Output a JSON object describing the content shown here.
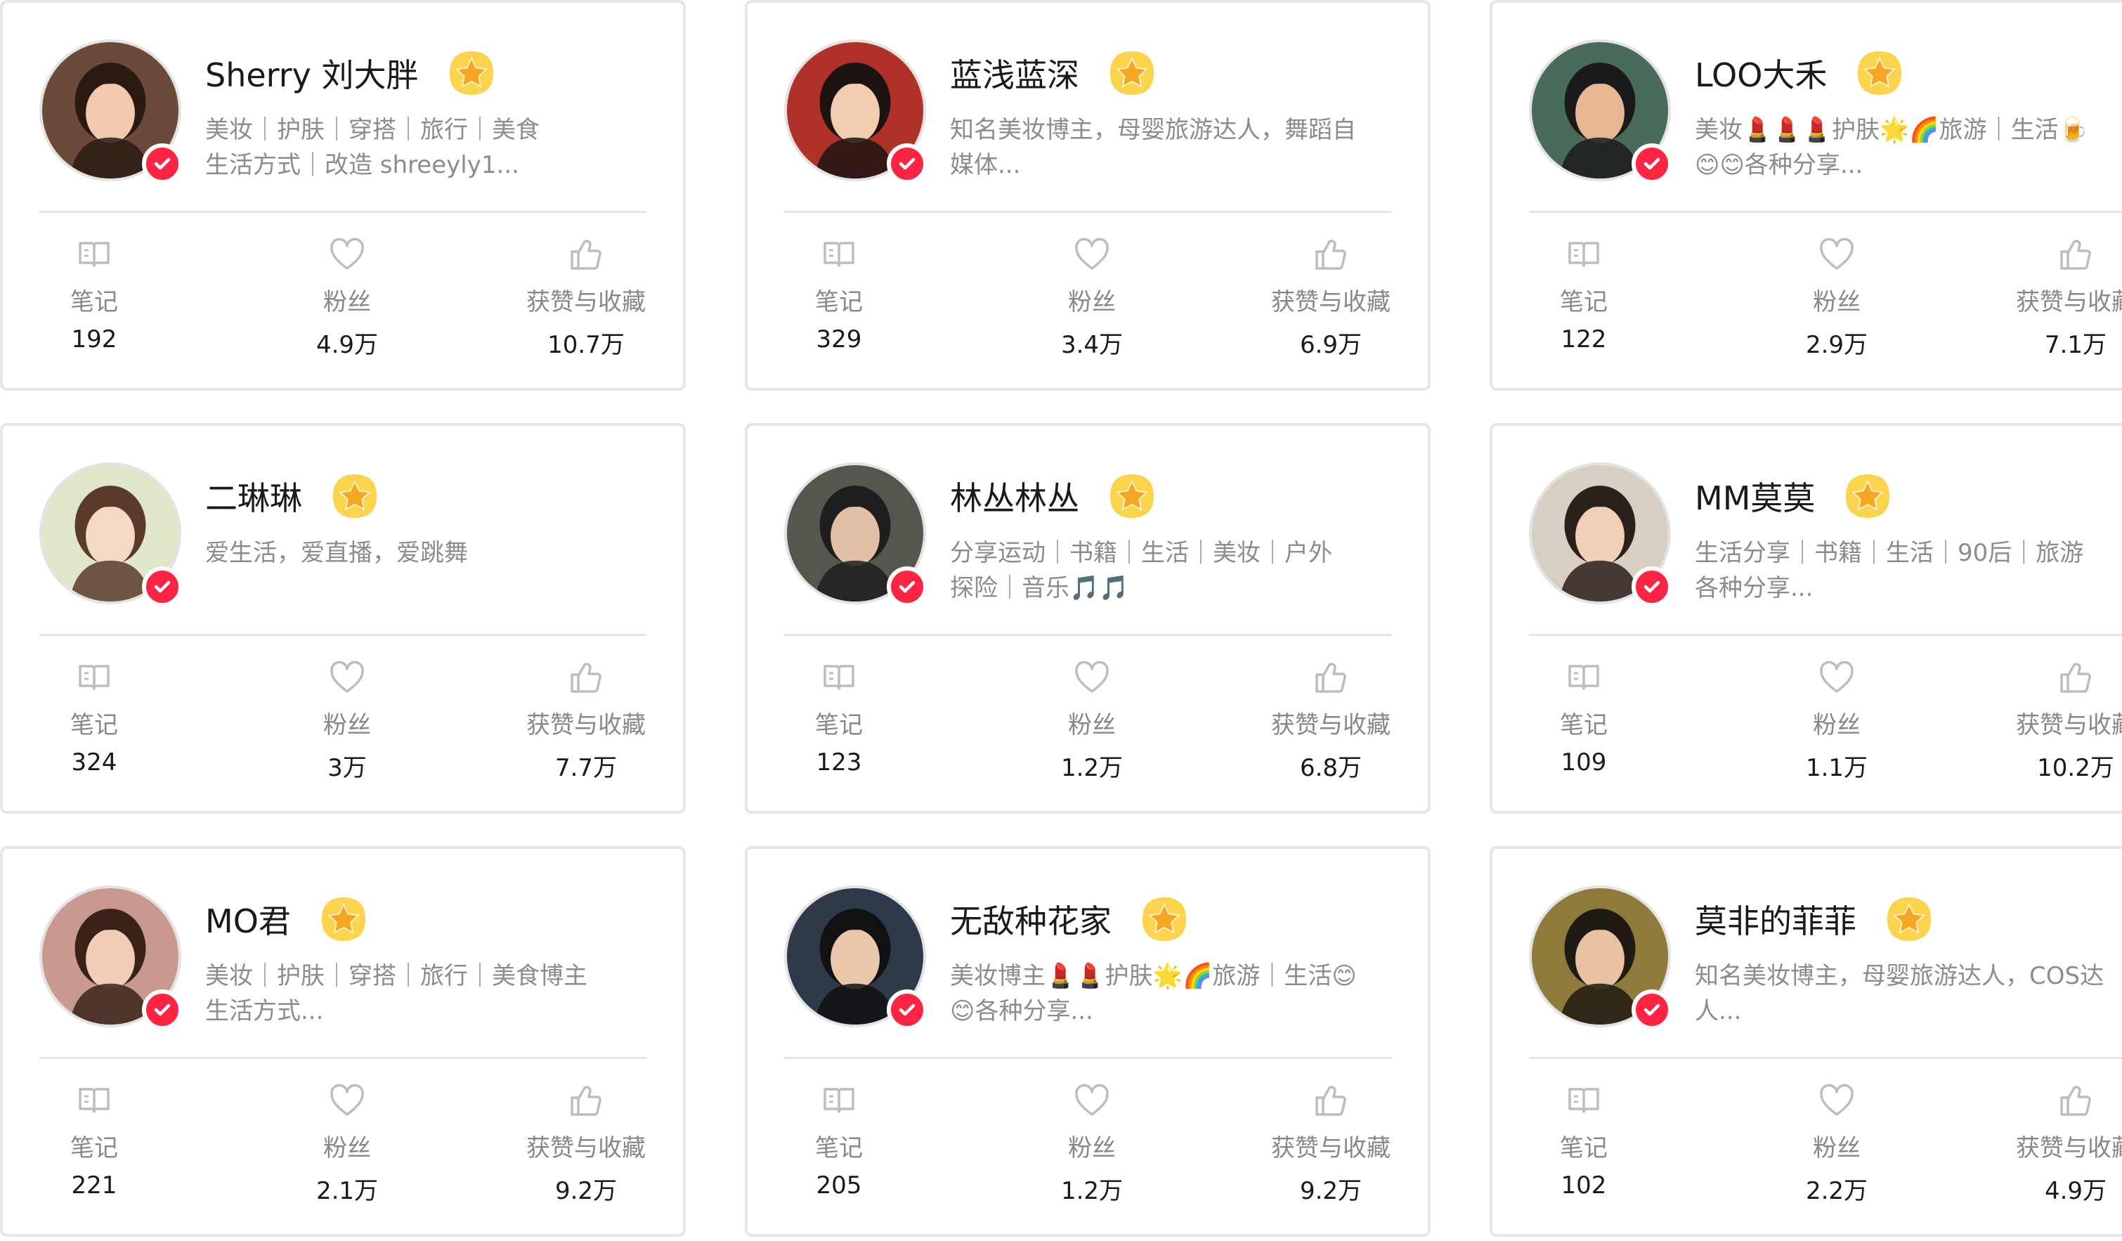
{
  "colors": {
    "verified": "#ff2442",
    "star": "#f5b400",
    "border": "#e6e6e6",
    "bio": "#8c8c8c"
  },
  "icons": {
    "notes": "book-icon",
    "fans": "heart-icon",
    "likes": "thumbs-up-icon",
    "verified": "check-icon",
    "badge": "star-icon"
  },
  "cards": [
    {
      "name": "Sherry 刘大胖",
      "bio_line1": "美妆｜护肤｜穿搭｜旅行｜美食",
      "bio_line2": "生活方式｜改造 shreeyly1...",
      "notes_label": "笔记",
      "notes": "192",
      "fans_label": "粉丝",
      "fans": "4.9万",
      "likes_label": "获赞与收藏",
      "likes": "10.7万",
      "avatar_bg": "#6b4a3a"
    },
    {
      "name": "蓝浅蓝深",
      "bio_line1": "知名美妆博主，母婴旅游达人，舞蹈自",
      "bio_line2": "媒体...",
      "notes_label": "笔记",
      "notes": "329",
      "fans_label": "粉丝",
      "fans": "3.4万",
      "likes_label": "获赞与收藏",
      "likes": "6.9万",
      "avatar_bg": "#b0302a"
    },
    {
      "name": "LOO大禾",
      "bio_line1": "美妆💄💄💄护肤🌟🌈旅游｜生活🍺",
      "bio_line2": "😊😊各种分享...",
      "notes_label": "笔记",
      "notes": "122",
      "fans_label": "粉丝",
      "fans": "2.9万",
      "likes_label": "获赞与收藏",
      "likes": "7.1万",
      "avatar_bg": "#4a6a5a"
    },
    {
      "name": "二琳琳",
      "bio_line1": "爱生活，爱直播，爱跳舞",
      "bio_line2": "",
      "notes_label": "笔记",
      "notes": "324",
      "fans_label": "粉丝",
      "fans": "3万",
      "likes_label": "获赞与收藏",
      "likes": "7.7万",
      "avatar_bg": "#dfe7c8"
    },
    {
      "name": "林丛林丛",
      "bio_line1": "分享运动｜书籍｜生活｜美妆｜户外",
      "bio_line2": "探险｜音乐🎵🎵",
      "notes_label": "笔记",
      "notes": "123",
      "fans_label": "粉丝",
      "fans": "1.2万",
      "likes_label": "获赞与收藏",
      "likes": "6.8万",
      "avatar_bg": "#55574e"
    },
    {
      "name": "MM莫莫",
      "bio_line1": "生活分享｜书籍｜生活｜90后｜旅游",
      "bio_line2": "各种分享...",
      "notes_label": "笔记",
      "notes": "109",
      "fans_label": "粉丝",
      "fans": "1.1万",
      "likes_label": "获赞与收藏",
      "likes": "10.2万",
      "avatar_bg": "#d8cfc4"
    },
    {
      "name": "MO君",
      "bio_line1": "美妆｜护肤｜穿搭｜旅行｜美食博主",
      "bio_line2": "生活方式...",
      "notes_label": "笔记",
      "notes": "221",
      "fans_label": "粉丝",
      "fans": "2.1万",
      "likes_label": "获赞与收藏",
      "likes": "9.2万",
      "avatar_bg": "#c9988e"
    },
    {
      "name": "无敌种花家",
      "bio_line1": "美妆博主💄💄护肤🌟🌈旅游｜生活😊",
      "bio_line2": "😊各种分享...",
      "notes_label": "笔记",
      "notes": "205",
      "fans_label": "粉丝",
      "fans": "1.2万",
      "likes_label": "获赞与收藏",
      "likes": "9.2万",
      "avatar_bg": "#2e3a4a"
    },
    {
      "name": "莫非的菲菲",
      "bio_line1": "知名美妆博主，母婴旅游达人，COS达",
      "bio_line2": "人...",
      "notes_label": "笔记",
      "notes": "102",
      "fans_label": "粉丝",
      "fans": "2.2万",
      "likes_label": "获赞与收藏",
      "likes": "4.9万",
      "avatar_bg": "#8e7a3a"
    }
  ]
}
